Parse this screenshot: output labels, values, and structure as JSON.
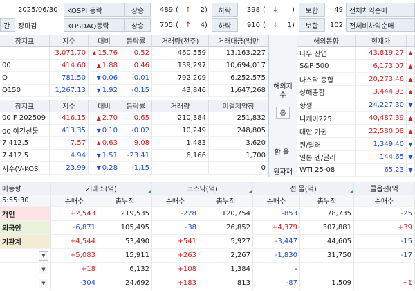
{
  "top": {
    "row1": {
      "date": "2025/06/30",
      "market": "KOSPI 등락",
      "up_label": "상승",
      "up_count": "489",
      "up_limit_open": "(",
      "up_arrow": "↑",
      "up_limit": "2",
      "up_limit_close": ")",
      "down_label": "하락",
      "down_count": "398",
      "down_open": "(",
      "down_arrow": "↓",
      "down_limit": "",
      "down_close": ")",
      "flat_label": "보합",
      "flat_count": "49",
      "arb_label": "전체차익순매"
    },
    "row2": {
      "session_left": "간",
      "session": "장마감",
      "market": "KOSDAQ등락",
      "up_label": "상승",
      "up_count": "705",
      "up_open": "(",
      "up_arrow": "↑",
      "up_limit": "4",
      "up_close": ")",
      "down_label": "하락",
      "down_count": "910",
      "down_open": "(",
      "down_arrow": "↓",
      "down_limit": "1",
      "down_close": ")",
      "flat_label": "보합",
      "flat_count": "102",
      "arb_label": "전체비차익순매"
    }
  },
  "domestic": {
    "headers": [
      "장지표",
      "지수",
      "대비",
      "등락률",
      "거래량(천주)",
      "거래대금(백만"
    ],
    "rows": [
      {
        "name": "",
        "index": "3,071.70",
        "dir": "up",
        "change": "15.76",
        "rate": "0.52",
        "volume": "460,559",
        "value": "13,163,227",
        "color": "red"
      },
      {
        "name": "00",
        "index": "414.60",
        "dir": "up",
        "change": "1.88",
        "rate": "0.46",
        "volume": "139,297",
        "value": "10,694,017",
        "color": "red"
      },
      {
        "name": "Q",
        "index": "781.50",
        "dir": "down",
        "change": "0.06",
        "rate": "-0.01",
        "volume": "792,209",
        "value": "6,252,575",
        "color": "blue"
      },
      {
        "name": "Q150",
        "index": "1,267.13",
        "dir": "down",
        "change": "1.92",
        "rate": "-0.15",
        "volume": "43,846",
        "value": "1,647,268",
        "color": "blue"
      }
    ]
  },
  "futures": {
    "headers": [
      "장지표",
      "지수",
      "대비",
      "등락률",
      "거래량",
      "미결제약정"
    ],
    "rows": [
      {
        "name": "00 F 202509",
        "index": "416.15",
        "dir": "up",
        "change": "2.70",
        "rate": "0.65",
        "volume": "210,384",
        "oi": "251,832",
        "color": "red"
      },
      {
        "name": "00 야간선물",
        "index": "413.35",
        "dir": "down",
        "change": "0.10",
        "rate": "-0.02",
        "volume": "10,249",
        "oi": "248,805",
        "color": "blue"
      },
      {
        "name": "7 412.5",
        "index": "7.57",
        "dir": "up",
        "change": "0.63",
        "rate": "9.08",
        "volume": "1,483",
        "oi": "3,620",
        "color": "red"
      },
      {
        "name": "7 412.5",
        "index": "4.94",
        "dir": "down",
        "change": "1.51",
        "rate": "-23.41",
        "volume": "6,166",
        "oi": "1,700",
        "color": "blue"
      },
      {
        "name": "지수(V-KOS",
        "index": "23.99",
        "dir": "down",
        "change": "0.28",
        "rate": "-1.15",
        "volume": "",
        "oi": "0",
        "color": "blue"
      }
    ]
  },
  "side": {
    "overseas_label": "해외지수",
    "fx_label": "환율",
    "commodity_label": "원자재"
  },
  "overseas": {
    "headers": [
      "해외동향",
      "현재가"
    ],
    "rows": [
      {
        "name": "다우 산업",
        "price": "43,819.27",
        "color": "red",
        "dir": "up"
      },
      {
        "name": "S&P 500",
        "price": "6,173.07",
        "color": "red",
        "dir": "up"
      },
      {
        "name": "나스닥 종합",
        "price": "20,273.46",
        "color": "red",
        "dir": "up"
      },
      {
        "name": "상해종합",
        "price": "3,444.93",
        "color": "red",
        "dir": "up"
      },
      {
        "name": "항셍",
        "price": "24,227.30",
        "color": "blue",
        "dir": "down"
      },
      {
        "name": "니케이225",
        "price": "40,487.39",
        "color": "red",
        "dir": "up"
      },
      {
        "name": "대만 가권",
        "price": "22,580.08",
        "color": "red",
        "dir": "up"
      },
      {
        "name": "원/달러",
        "price": "1,349.40",
        "color": "blue",
        "dir": "down"
      },
      {
        "name": "일본 엔/달러",
        "price": "144.65",
        "color": "blue",
        "dir": "down"
      },
      {
        "name": "WTI 25-08",
        "price": "65.23",
        "color": "blue",
        "dir": "down"
      }
    ]
  },
  "investors": {
    "title": "매동향",
    "time": "5:55:30",
    "groups": [
      "거래소(억)",
      "코스닥(억)",
      "선 물(억)",
      "콜옵션(억"
    ],
    "subheaders": [
      "순매수",
      "총누적",
      "순매수",
      "총누적",
      "순매수",
      "총누적",
      "순매수"
    ],
    "rows": [
      {
        "name": "개인",
        "bg": "#fde3e3",
        "combo": false,
        "v": [
          "+2,543",
          "219,535",
          "-228",
          "120,754",
          "-853",
          "78,735",
          "-25"
        ],
        "c": [
          "red",
          "",
          "blue",
          "",
          "blue",
          "",
          "blue"
        ]
      },
      {
        "name": "외국인",
        "bg": "#e9f3dc",
        "combo": false,
        "v": [
          "-6,871",
          "105,495",
          "-38",
          "26,852",
          "+4,379",
          "307,881",
          "+39"
        ],
        "c": [
          "blue",
          "",
          "blue",
          "",
          "red",
          "",
          "red"
        ]
      },
      {
        "name": "기관계",
        "bg": "#f5ecd6",
        "combo": false,
        "v": [
          "+4,544",
          "53,490",
          "+541",
          "5,927",
          "-3,447",
          "44,605",
          "-15"
        ],
        "c": [
          "red",
          "",
          "red",
          "",
          "blue",
          "",
          "blue"
        ]
      },
      {
        "name": "",
        "bg": "#ffffff",
        "combo": true,
        "v": [
          "+5,083",
          "15,911",
          "+263",
          "2,267",
          "-1,830",
          "31,750",
          "-17"
        ],
        "c": [
          "red",
          "",
          "red",
          "",
          "blue",
          "",
          "blue"
        ]
      },
      {
        "name": "",
        "bg": "#ffffff",
        "combo": true,
        "v": [
          "+18",
          "6,132",
          "+108",
          "1,384",
          "-",
          "",
          ""
        ],
        "c": [
          "red",
          "",
          "red",
          "",
          "",
          "",
          ""
        ]
      },
      {
        "name": "",
        "bg": "#ffffff",
        "combo": true,
        "v": [
          "-304",
          "24,692",
          "+183",
          "813",
          "-87",
          "1,509",
          "+1"
        ],
        "c": [
          "blue",
          "",
          "red",
          "",
          "blue",
          "",
          "red"
        ]
      }
    ]
  }
}
